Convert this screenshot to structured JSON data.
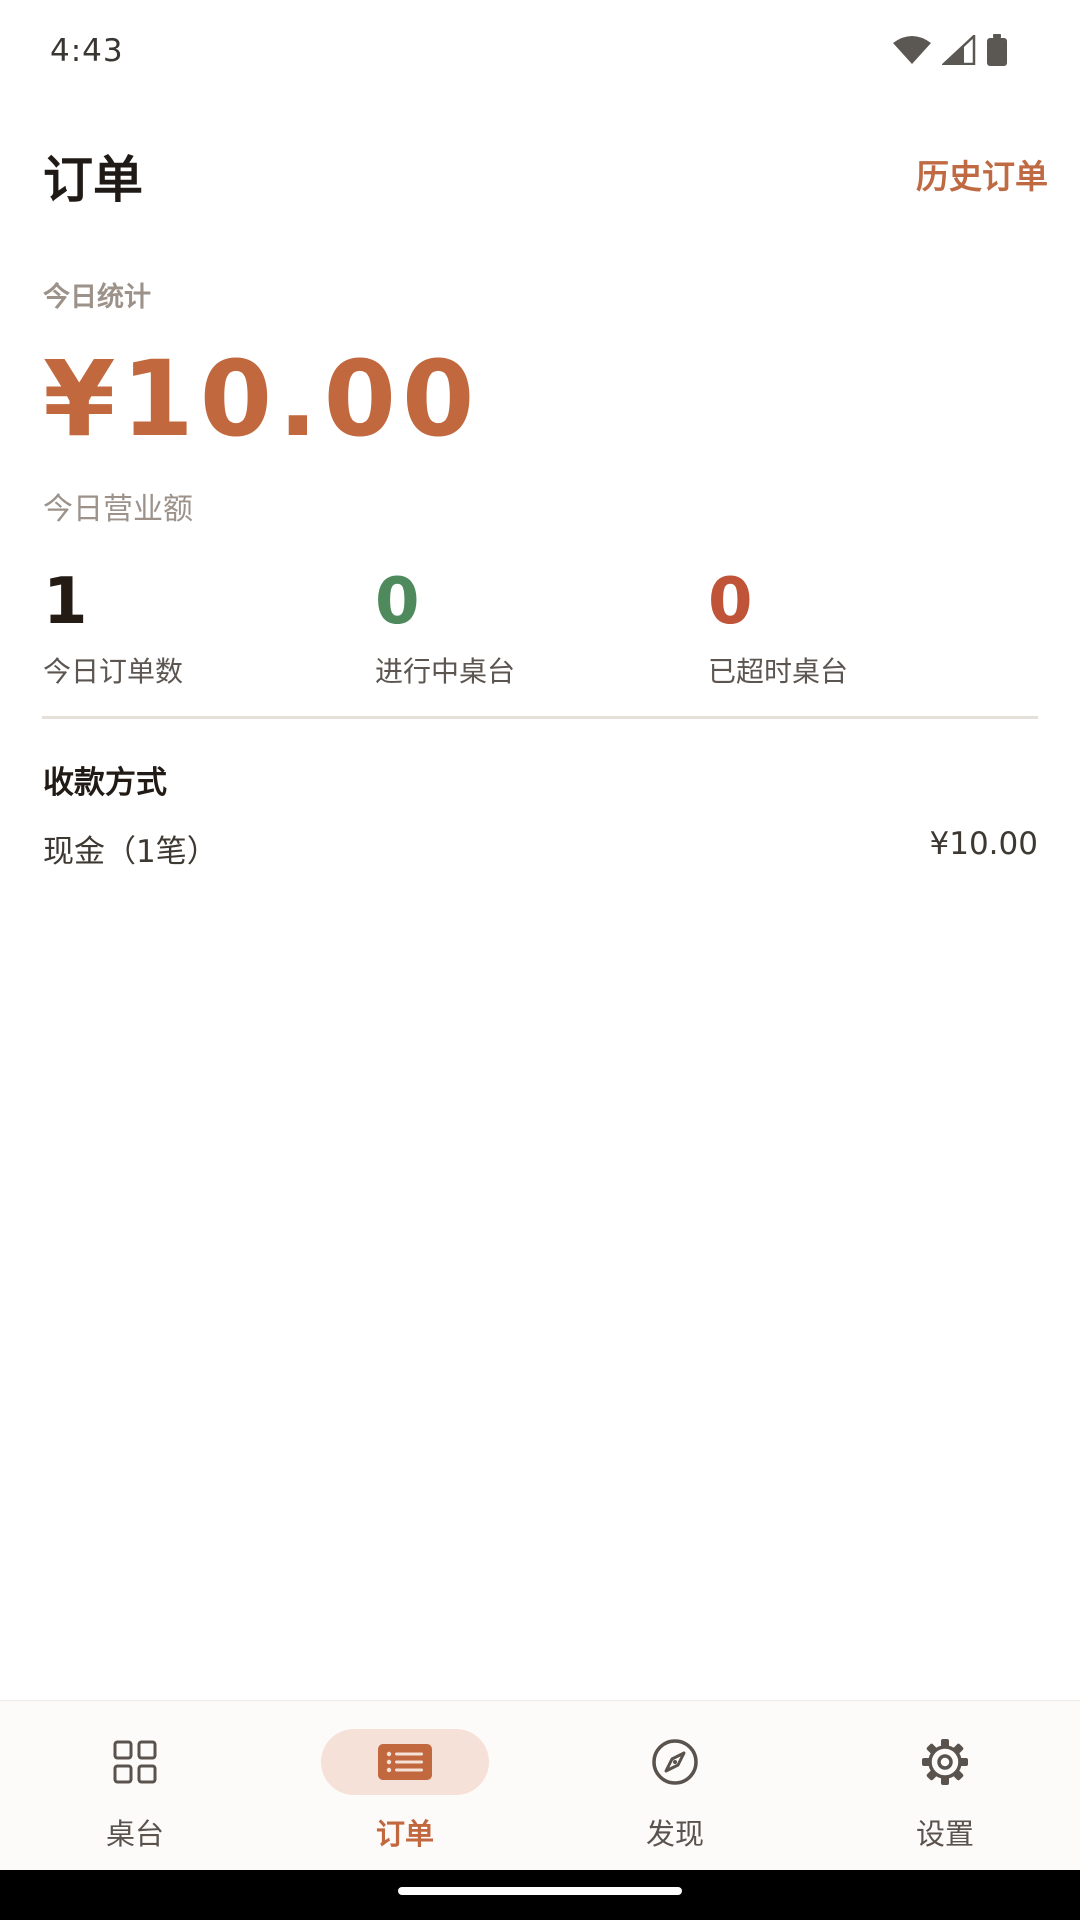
{
  "status_bar": {
    "time": "4:43",
    "icons": [
      "wifi-icon",
      "cellular-signal-icon",
      "battery-icon"
    ]
  },
  "header": {
    "title": "订单",
    "history_link": "历史订单"
  },
  "stats": {
    "heading": "今日统计",
    "revenue": "¥10.00",
    "revenue_label": "今日营业额",
    "metrics": [
      {
        "value": "1",
        "label": "今日订单数",
        "color": "#231b14"
      },
      {
        "value": "0",
        "label": "进行中桌台",
        "color": "#4e8a5c"
      },
      {
        "value": "0",
        "label": "已超时桌台",
        "color": "#bf5438"
      }
    ]
  },
  "payment": {
    "heading": "收款方式",
    "rows": [
      {
        "method": "现金（1笔）",
        "amount": "¥10.00"
      }
    ]
  },
  "bottom_nav": {
    "items": [
      {
        "label": "桌台",
        "icon": "grid-icon",
        "active": false
      },
      {
        "label": "订单",
        "icon": "order-list-icon",
        "active": true
      },
      {
        "label": "发现",
        "icon": "compass-icon",
        "active": false
      },
      {
        "label": "设置",
        "icon": "gear-icon",
        "active": false
      }
    ]
  },
  "colors": {
    "accent": "#c2683f",
    "accent_light": "#f5e1d7",
    "muted_text": "#9c928a"
  }
}
